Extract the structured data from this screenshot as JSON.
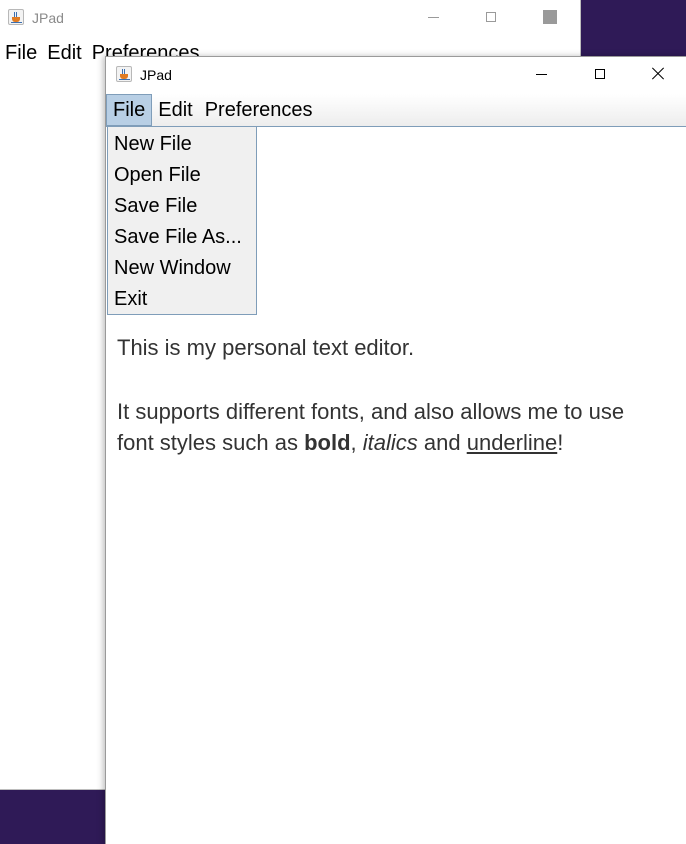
{
  "back_window": {
    "title": "JPad",
    "menu": [
      "File",
      "Edit",
      "Preferences"
    ]
  },
  "front_window": {
    "title": "JPad",
    "menu": [
      "File",
      "Edit",
      "Preferences"
    ],
    "open_menu": "File",
    "file_menu_items": [
      "New File",
      "Open File",
      "Save File",
      "Save File As...",
      "New Window",
      "Exit"
    ],
    "editor": {
      "line1": "This is my personal text editor.",
      "line2": "It supports different fonts, and also allows me to use",
      "line3_prefix": "font styles such as ",
      "bold_word": "bold",
      "sep": ", ",
      "italic_word": "italics",
      "and_word": " and ",
      "underline_word": "underline",
      "end": "!"
    }
  },
  "colors": {
    "desktop": "#2f1a57",
    "menu_highlight": "#b8cfe5",
    "menu_border": "#7f9db9",
    "text": "#333333"
  },
  "icons": [
    "java-app-icon",
    "minimize-icon",
    "maximize-icon",
    "close-icon"
  ]
}
